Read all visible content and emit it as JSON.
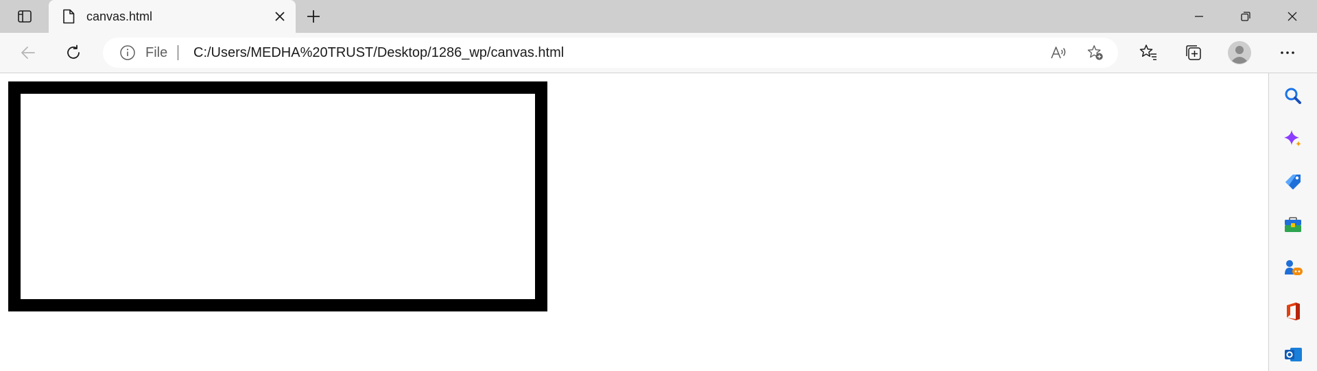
{
  "browser": {
    "tab": {
      "title": "canvas.html",
      "favicon": "file-icon"
    },
    "address_bar": {
      "scheme_label": "File",
      "url": "C:/Users/MEDHA%20TRUST/Desktop/1286_wp/canvas.html"
    },
    "window_controls": [
      "minimize",
      "restore",
      "close"
    ],
    "toolbar_icons": [
      "back-arrow-icon",
      "refresh-icon",
      "read-aloud-icon",
      "add-favorite-icon",
      "favorites-icon",
      "collections-icon",
      "profile-avatar",
      "more-icon"
    ],
    "sidebar_icons": [
      "search-icon",
      "copilot-icon",
      "shopping-icon",
      "tools-icon",
      "games-icon",
      "office-icon",
      "outlook-icon"
    ]
  },
  "page": {
    "canvas": {
      "border_color": "#000000",
      "fill_color": "#ffffff"
    }
  },
  "colors": {
    "titlebar": "#cfcfcf",
    "toolbar": "#f7f7f7",
    "accent_blue": "#0f6cbd"
  }
}
